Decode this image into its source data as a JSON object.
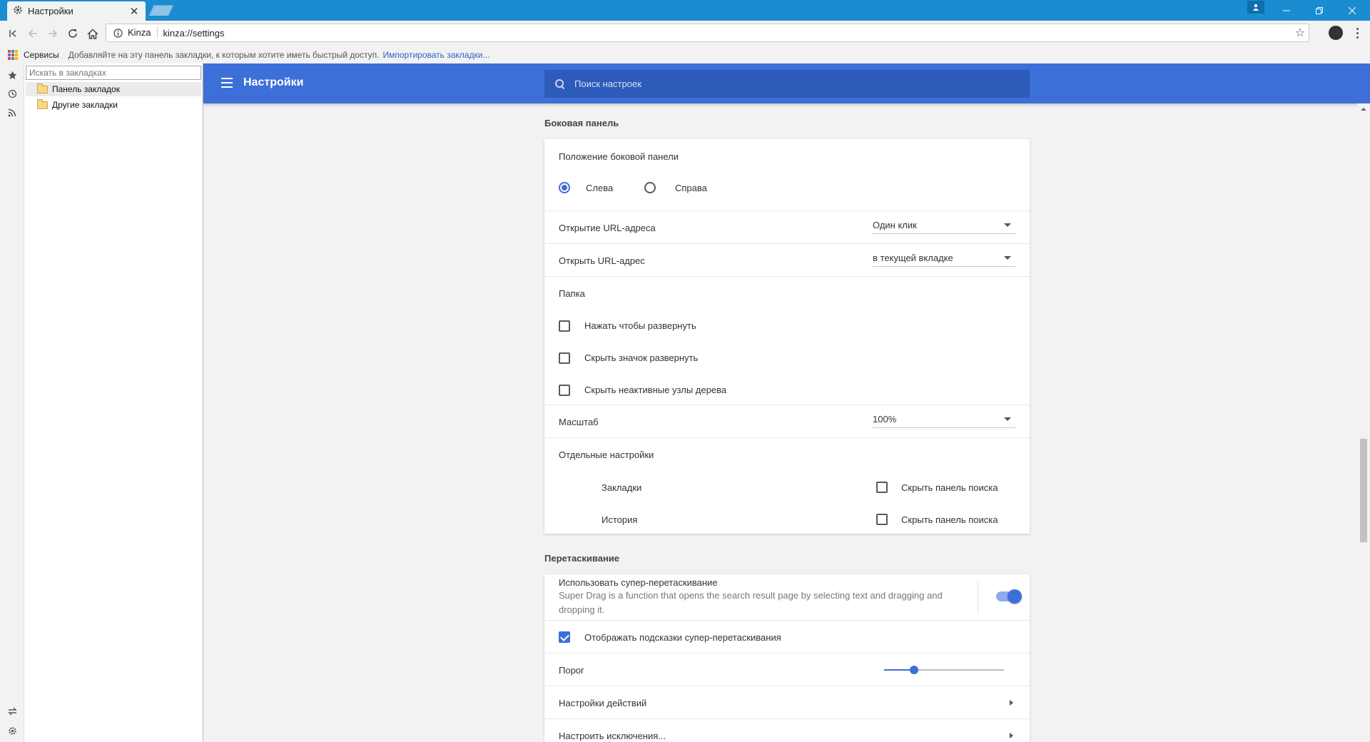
{
  "browser": {
    "tab_title": "Настройки",
    "omnibox_site": "Kinza",
    "omnibox_url": "kinza://settings"
  },
  "bookmarks_bar": {
    "services": "Сервисы",
    "hint": "Добавляйте на эту панель закладки, к которым хотите иметь быстрый доступ.",
    "import": "Импортировать закладки..."
  },
  "bookmarks_panel": {
    "search_placeholder": "Искать в закладках",
    "items": [
      {
        "label": "Панель закладок"
      },
      {
        "label": "Другие закладки"
      }
    ]
  },
  "settings": {
    "title": "Настройки",
    "search_placeholder": "Поиск настроек"
  },
  "sidebar_section": {
    "title": "Боковая панель",
    "position_label": "Положение боковой панели",
    "position_left": "Слева",
    "position_right": "Справа",
    "position_selected": "left",
    "url_open_label": "Открытие URL-адреса",
    "url_open_value": "Один клик",
    "open_url_label": "Открыть URL-адрес",
    "open_url_value": "в текущей вкладке",
    "folder_label": "Папка",
    "folder_options": [
      {
        "label": "Нажать чтобы развернуть",
        "checked": false
      },
      {
        "label": "Скрыть значок развернуть",
        "checked": false
      },
      {
        "label": "Скрыть неактивные узлы дерева",
        "checked": false
      }
    ],
    "scale_label": "Масштаб",
    "scale_value": "100%",
    "separate_label": "Отдельные настройки",
    "separate_items": [
      {
        "label": "Закладки",
        "option": "Скрыть панель поиска",
        "checked": false
      },
      {
        "label": "История",
        "option": "Скрыть панель поиска",
        "checked": false
      }
    ]
  },
  "drag_section": {
    "title": "Перетаскивание",
    "super_drag_label": "Использовать супер-перетаскивание",
    "super_drag_desc_line1": "Super Drag is a function that opens the search result page by selecting text and dragging and",
    "super_drag_desc_line2": "dropping it.",
    "super_drag_enabled": true,
    "hints_label": "Отображать подсказки супер-перетаскивания",
    "hints_checked": true,
    "threshold_label": "Порог",
    "threshold_fraction": 0.25,
    "actions_label": "Настройки действий",
    "exceptions_label": "Настроить исключения..."
  },
  "colors": {
    "accent": "#3d6fd9",
    "titlebar": "#1a8cd0"
  }
}
